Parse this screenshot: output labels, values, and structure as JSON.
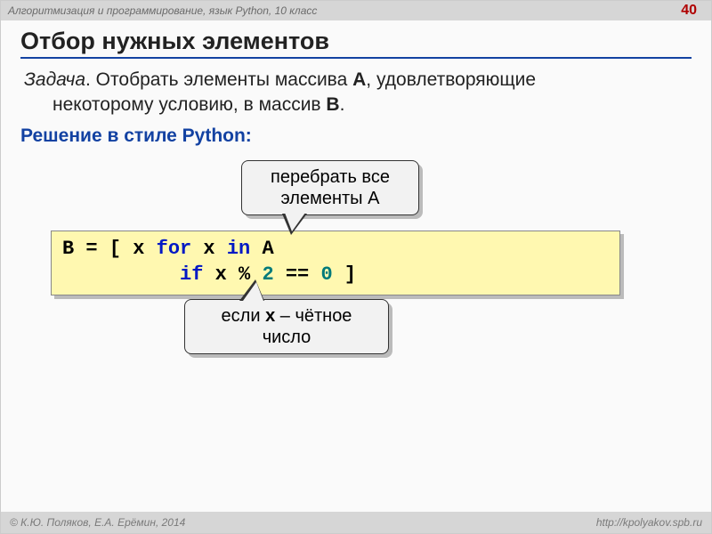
{
  "header": {
    "course": "Алгоритмизация и программирование, язык Python, 10 класс",
    "page": "40"
  },
  "title": "Отбор нужных элементов",
  "task": {
    "label": "Задача",
    "line1_a": ". Отобрать элементы массива ",
    "A": "A",
    "line1_b": ", удовлетворяющие",
    "line2_a": "некоторому условию, в массив  ",
    "B": "B",
    "line2_b": "."
  },
  "solution_label": "Решение в стиле Python:",
  "callouts": {
    "top_l1": "перебрать все",
    "top_l2": "элементы A",
    "bot_before": "если ",
    "bot_x": "x",
    "bot_after": " – чётное",
    "bot_l2": "число"
  },
  "code": {
    "t1": "B = [ x ",
    "for": "for",
    "t2": " x ",
    "in": "in",
    "t3": " A",
    "indent": "          ",
    "if": "if",
    "t4": " x % ",
    "two": "2",
    "t5": " == ",
    "zero": "0",
    "t6": " ]"
  },
  "footer": {
    "copyright": "© К.Ю. Поляков, Е.А. Ерёмин, 2014",
    "url": "http://kpolyakov.spb.ru"
  }
}
